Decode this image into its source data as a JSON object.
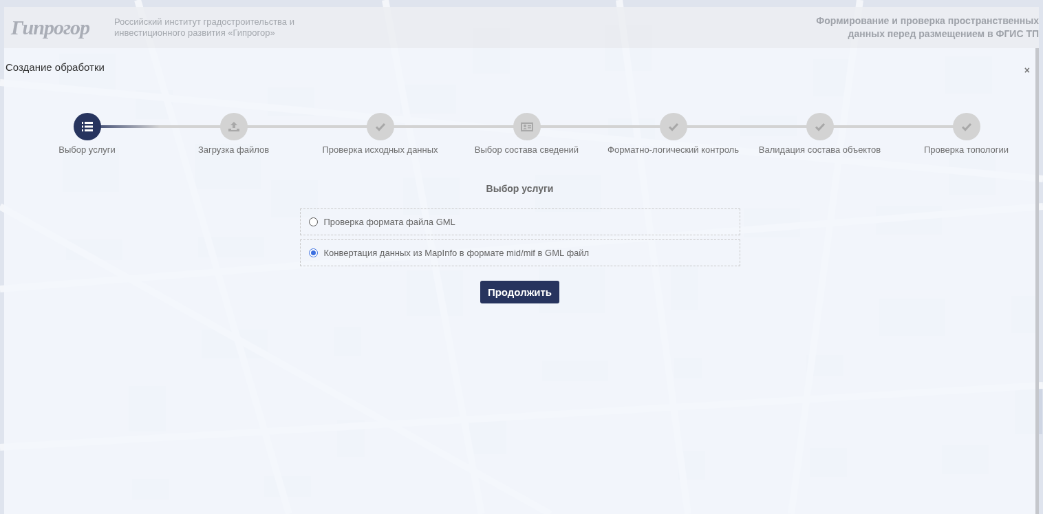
{
  "header": {
    "logo": "Гипрогор",
    "institute": "Российский институт градостроительства и инвестиционного развития «Гипрогор»",
    "service_lines": [
      "Формирование и проверка пространственных",
      "данных перед размещением в ФГИС ТП"
    ]
  },
  "dialog": {
    "title": "Создание обработки",
    "close": "×"
  },
  "steps": [
    {
      "label": "Выбор услуги",
      "kind": "list",
      "active": true
    },
    {
      "label": "Загрузка файлов",
      "kind": "upload",
      "active": false
    },
    {
      "label": "Проверка исходных данных",
      "kind": "check",
      "active": false
    },
    {
      "label": "Выбор состава сведений",
      "kind": "card",
      "active": false
    },
    {
      "label": "Форматно-логический контроль",
      "kind": "check",
      "active": false
    },
    {
      "label": "Валидация состава объектов",
      "kind": "check",
      "active": false
    },
    {
      "label": "Проверка топологии",
      "kind": "check",
      "active": false
    }
  ],
  "section_title": "Выбор услуги",
  "options": [
    {
      "label": "Проверка формата файла GML",
      "selected": false
    },
    {
      "label": "Конвертация данных из MapInfo в формате mid/mif в GML файл",
      "selected": true
    }
  ],
  "continue_button": "Продолжить"
}
